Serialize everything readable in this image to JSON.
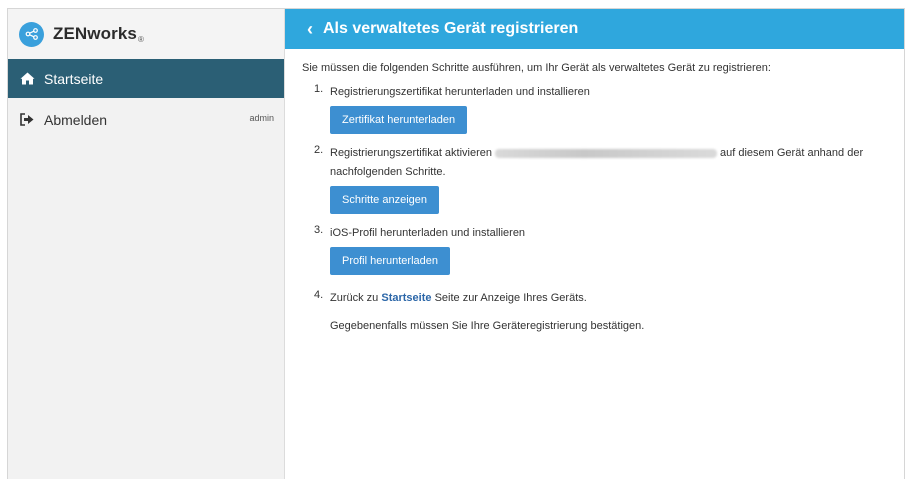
{
  "brand": {
    "name": "ZENworks",
    "reg": "®"
  },
  "sidebar": {
    "items": [
      {
        "label": "Startseite",
        "icon": "home-icon"
      },
      {
        "label": "Abmelden",
        "icon": "logout-icon",
        "user": "admin"
      }
    ]
  },
  "header": {
    "back_glyph": "‹",
    "title": "Als verwaltetes Gerät registrieren"
  },
  "main": {
    "intro": "Sie müssen die folgenden Schritte ausführen, um Ihr Gerät als verwaltetes Gerät zu registrieren:",
    "steps": [
      {
        "num": "1.",
        "text": "Registrierungszertifikat herunterladen und installieren",
        "button": "Zertifikat herunterladen"
      },
      {
        "num": "2.",
        "text_before": "Registrierungszertifikat aktivieren",
        "text_after": "auf diesem Gerät anhand der nachfolgenden Schritte.",
        "button": "Schritte anzeigen"
      },
      {
        "num": "3.",
        "text": "iOS-Profil herunterladen und installieren",
        "button": "Profil herunterladen"
      },
      {
        "num": "4.",
        "text_before": "Zurück zu",
        "link": "Startseite",
        "text_after": "Seite zur Anzeige Ihres Geräts."
      }
    ],
    "note": "Gegebenenfalls müssen Sie Ihre Geräteregistrierung bestätigen."
  },
  "colors": {
    "header": "#2fa7dd",
    "active_nav": "#2b5f75",
    "button": "#3d8fd1",
    "link": "#2b66a8"
  }
}
